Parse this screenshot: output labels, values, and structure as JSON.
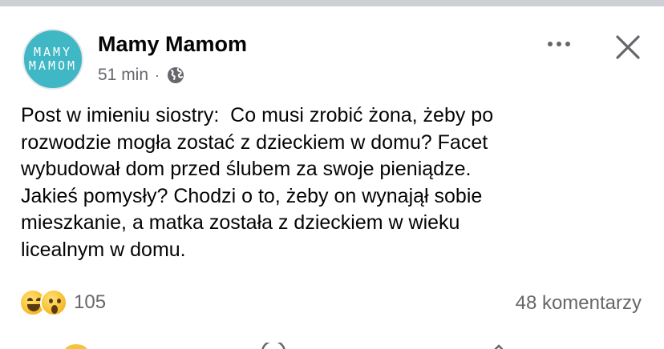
{
  "post": {
    "page_name": "Mamy Mamom",
    "avatar_text_line1": "MAMY",
    "avatar_text_line2": "MAMOM",
    "time": "51 min",
    "separator": "·",
    "audience_icon": "globe-icon",
    "text": "Post w imieniu siostry:  Co musi zrobić żona, żeby po\nrozwodzie mogła zostać z dzieckiem w domu? Facet\nwybudował dom przed ślubem za swoje pieniądze.\nJakieś pomysły? Chodzi o to, żeby on wynajął sobie\nmieszkanie, a matka została z dzieckiem w wieku\nlicealnym w domu.",
    "reactions": {
      "icons": [
        "haha-emoji",
        "wow-emoji"
      ],
      "count": "105"
    },
    "comments_label": "48 komentarzy"
  },
  "colors": {
    "text_primary": "#050505",
    "text_secondary": "#65676b",
    "avatar_bg": "#3fb7c4",
    "top_strip": "#cdd0d5"
  }
}
